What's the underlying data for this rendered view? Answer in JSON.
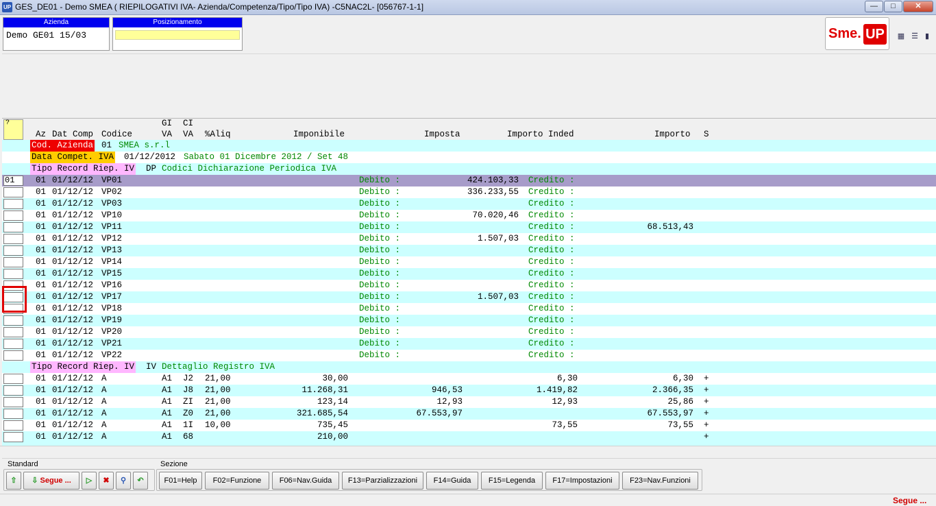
{
  "window": {
    "title": "GES_DE01 - Demo SMEA ( RIEPILOGATIVI IVA- Azienda/Competenza/Tipo/Tipo IVA) -C5NAC2L- [056767-1-1]",
    "app_icon": "UP"
  },
  "header": {
    "azienda_label": "Azienda",
    "azienda_value": "Demo GE01 15/03",
    "posizionamento_label": "Posizionamento",
    "posizionamento_value": "",
    "logo_left": "Sme.",
    "logo_right": "UP"
  },
  "grid": {
    "question_mark": "?",
    "headers": {
      "az": "Az",
      "dat_comp": "Dat Comp",
      "codice": "Codice",
      "gi_1": "GI",
      "gi_2": "VA",
      "ci_1": "CI",
      "ci_2": "VA",
      "aliq": "%Aliq",
      "imponibile": "Imponibile",
      "imposta": "Imposta",
      "importo_inded": "Importo Inded",
      "importo": "Importo",
      "s": "S"
    },
    "cod_azienda": {
      "label": "Cod. Azienda",
      "code": "01",
      "desc": "SMEA s.r.l"
    },
    "data_compet": {
      "label": "Data Compet. IVA",
      "code": "01/12/2012",
      "desc": "Sabato 01 Dicembre 2012 / Set 48"
    },
    "tipo_dp": {
      "label": "Tipo Record Riep. IV",
      "code": "DP",
      "desc": "Codici Dichiarazione Periodica IVA"
    },
    "selected_input": "01",
    "debito_label": "Debito :",
    "credito_label": "Credito :",
    "dp_rows": [
      {
        "az": "01",
        "date": "01/12/12",
        "codice": "VP01",
        "debito": "424.103,33",
        "credito": ""
      },
      {
        "az": "01",
        "date": "01/12/12",
        "codice": "VP02",
        "debito": "336.233,55",
        "credito": ""
      },
      {
        "az": "01",
        "date": "01/12/12",
        "codice": "VP03",
        "debito": "",
        "credito": ""
      },
      {
        "az": "01",
        "date": "01/12/12",
        "codice": "VP10",
        "debito": "70.020,46",
        "credito": ""
      },
      {
        "az": "01",
        "date": "01/12/12",
        "codice": "VP11",
        "debito": "",
        "credito": "68.513,43"
      },
      {
        "az": "01",
        "date": "01/12/12",
        "codice": "VP12",
        "debito": "1.507,03",
        "credito": ""
      },
      {
        "az": "01",
        "date": "01/12/12",
        "codice": "VP13",
        "debito": "",
        "credito": ""
      },
      {
        "az": "01",
        "date": "01/12/12",
        "codice": "VP14",
        "debito": "",
        "credito": ""
      },
      {
        "az": "01",
        "date": "01/12/12",
        "codice": "VP15",
        "debito": "",
        "credito": ""
      },
      {
        "az": "01",
        "date": "01/12/12",
        "codice": "VP16",
        "debito": "",
        "credito": ""
      },
      {
        "az": "01",
        "date": "01/12/12",
        "codice": "VP17",
        "debito": "1.507,03",
        "credito": ""
      },
      {
        "az": "01",
        "date": "01/12/12",
        "codice": "VP18",
        "debito": "",
        "credito": ""
      },
      {
        "az": "01",
        "date": "01/12/12",
        "codice": "VP19",
        "debito": "",
        "credito": ""
      },
      {
        "az": "01",
        "date": "01/12/12",
        "codice": "VP20",
        "debito": "",
        "credito": ""
      },
      {
        "az": "01",
        "date": "01/12/12",
        "codice": "VP21",
        "debito": "",
        "credito": ""
      },
      {
        "az": "01",
        "date": "01/12/12",
        "codice": "VP22",
        "debito": "",
        "credito": ""
      }
    ],
    "tipo_iv": {
      "label": "Tipo Record Riep. IV",
      "code": "IV",
      "desc": "Dettaglio Registro IVA"
    },
    "iv_rows": [
      {
        "az": "01",
        "date": "01/12/12",
        "codice": "A",
        "gi": "A1",
        "ci": "J2",
        "aliq": "21,00",
        "imponibile": "30,00",
        "imposta": "",
        "inded": "6,30",
        "importo": "6,30",
        "s": "+"
      },
      {
        "az": "01",
        "date": "01/12/12",
        "codice": "A",
        "gi": "A1",
        "ci": "J8",
        "aliq": "21,00",
        "imponibile": "11.268,31",
        "imposta": "946,53",
        "inded": "1.419,82",
        "importo": "2.366,35",
        "s": "+"
      },
      {
        "az": "01",
        "date": "01/12/12",
        "codice": "A",
        "gi": "A1",
        "ci": "ZI",
        "aliq": "21,00",
        "imponibile": "123,14",
        "imposta": "12,93",
        "inded": "12,93",
        "importo": "25,86",
        "s": "+"
      },
      {
        "az": "01",
        "date": "01/12/12",
        "codice": "A",
        "gi": "A1",
        "ci": "Z0",
        "aliq": "21,00",
        "imponibile": "321.685,54",
        "imposta": "67.553,97",
        "inded": "",
        "importo": "67.553,97",
        "s": "+"
      },
      {
        "az": "01",
        "date": "01/12/12",
        "codice": "A",
        "gi": "A1",
        "ci": "1I",
        "aliq": "10,00",
        "imponibile": "735,45",
        "imposta": "",
        "inded": "73,55",
        "importo": "73,55",
        "s": "+"
      },
      {
        "az": "01",
        "date": "01/12/12",
        "codice": "A",
        "gi": "A1",
        "ci": "68",
        "aliq": "",
        "imponibile": "210,00",
        "imposta": "",
        "inded": "",
        "importo": "",
        "s": "+"
      }
    ]
  },
  "toolbar": {
    "standard_label": "Standard",
    "sezione_label": "Sezione",
    "segue_label": "Segue ...",
    "fkeys": [
      "F01=Help",
      "F02=Funzione",
      "F06=Nav.Guida",
      "F13=Parzializzazioni",
      "F14=Guida",
      "F15=Legenda",
      "F17=Impostazioni",
      "F23=Nav.Funzioni"
    ]
  },
  "status": {
    "segue": "Segue ..."
  },
  "colors": {
    "grid_cyan": "#ccffff",
    "selected_row": "#a79cc9",
    "green_text": "#008800",
    "red_label": "#ee0000",
    "orange_label": "#ffcc00",
    "pink_label": "#ffb7ff"
  }
}
